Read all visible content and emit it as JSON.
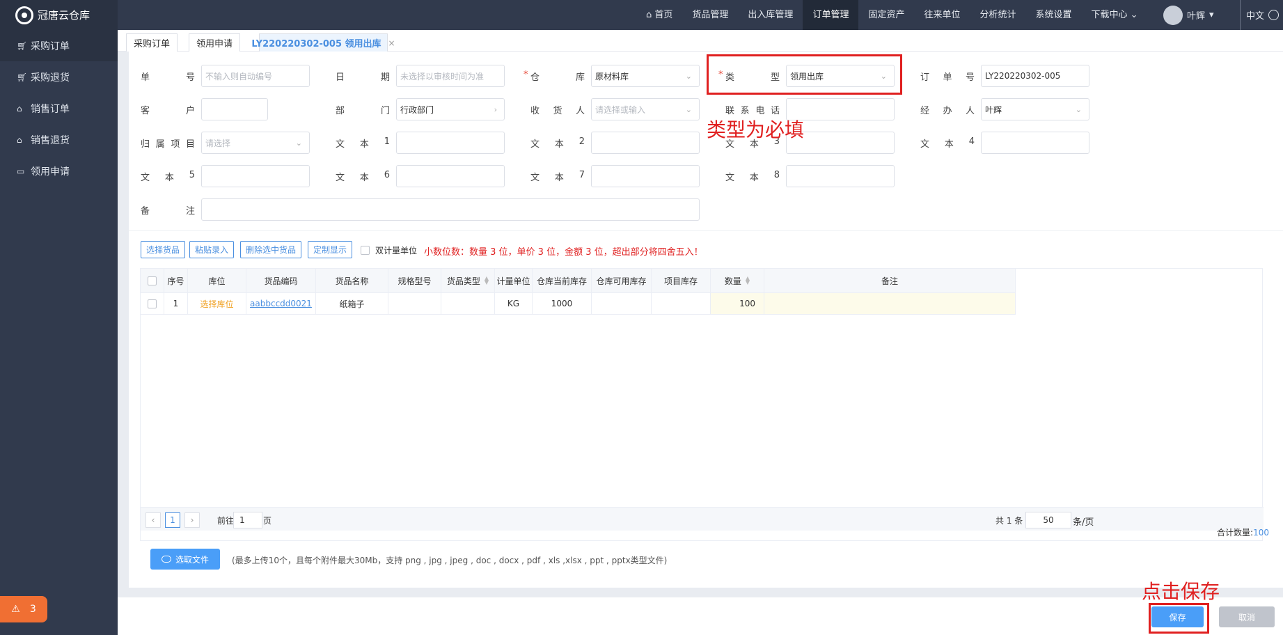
{
  "app": {
    "name": "冠唐云仓库"
  },
  "sidebar": {
    "items": [
      {
        "label": "采购订单",
        "icon": "cart-icon"
      },
      {
        "label": "采购退货",
        "icon": "cart-icon"
      },
      {
        "label": "销售订单",
        "icon": "bag-icon"
      },
      {
        "label": "销售退货",
        "icon": "bag-icon"
      },
      {
        "label": "领用申请",
        "icon": "box-icon"
      }
    ],
    "notice_count": "3"
  },
  "topnav": {
    "items": [
      "首页",
      "货品管理",
      "出入库管理",
      "订单管理",
      "固定资产",
      "往来单位",
      "分析统计",
      "系统设置",
      "下载中心"
    ],
    "active": "订单管理",
    "user": "叶辉",
    "lang": "中文"
  },
  "tabs": [
    "采购订单",
    "领用申请",
    "LY220220302-005 领用出库"
  ],
  "form": {
    "order_no": {
      "label": "单号",
      "placeholder": "不输入则自动编号"
    },
    "date": {
      "label": "日期",
      "placeholder": "未选择以审核时间为准"
    },
    "warehouse": {
      "label": "仓库",
      "value": "原材料库"
    },
    "type": {
      "label": "类型",
      "value": "领用出库"
    },
    "ref_no": {
      "label": "订单号",
      "value": "LY220220302-005"
    },
    "customer": {
      "label": "客户",
      "value": ""
    },
    "department": {
      "label": "部门",
      "value": "行政部门"
    },
    "receiver": {
      "label": "收货人",
      "placeholder": "请选择或输入"
    },
    "phone": {
      "label": "联系电话",
      "value": ""
    },
    "handler": {
      "label": "经办人",
      "value": "叶辉"
    },
    "project": {
      "label": "归属项目",
      "placeholder": "请选择"
    },
    "text1": {
      "label": "文本1"
    },
    "text2": {
      "label": "文本2"
    },
    "text3": {
      "label": "文本3"
    },
    "text4": {
      "label": "文本4"
    },
    "text5": {
      "label": "文本5"
    },
    "text6": {
      "label": "文本6"
    },
    "text7": {
      "label": "文本7"
    },
    "text8": {
      "label": "文本8"
    },
    "remark": {
      "label": "备注"
    }
  },
  "toolbar": {
    "select_goods": "选择货品",
    "paste_entry": "粘贴录入",
    "delete_selected": "删除选中货品",
    "custom_display": "定制显示",
    "dual_unit": "双计量单位",
    "decimal_hint": "小数位数：数量 3 位，单价 3 位，金额 3 位，超出部分将四舍五入！"
  },
  "table": {
    "headers": [
      "序号",
      "库位",
      "货品编码",
      "货品名称",
      "规格型号",
      "货品类型",
      "计量单位",
      "仓库当前库存",
      "仓库可用库存",
      "项目库存",
      "数量",
      "备注"
    ],
    "rows": [
      {
        "index": "1",
        "location": "选择库位",
        "code": "aabbccdd0021",
        "name": "纸箱子",
        "spec": "",
        "type": "",
        "unit": "KG",
        "stock": "1000",
        "available": "",
        "project_stock": "",
        "qty": "100",
        "remark": ""
      }
    ]
  },
  "pager": {
    "current": "1",
    "goto_label": "前往",
    "goto_value": "1",
    "page_suffix": "页",
    "total": "共 1 条",
    "page_size": "50",
    "page_size_suffix": "条/页"
  },
  "summary": {
    "label": "合计数量:",
    "value": "100"
  },
  "upload": {
    "button": "选取文件",
    "hint": "(最多上传10个，且每个附件最大30Mb，支持 png , jpg , jpeg , doc , docx , pdf , xls ,xlsx , ppt , pptx类型文件)"
  },
  "footer": {
    "save": "保存",
    "cancel": "取消"
  },
  "annotations": {
    "type_required": "类型为必填",
    "click_save": "点击保存",
    "color": "#e02020"
  }
}
